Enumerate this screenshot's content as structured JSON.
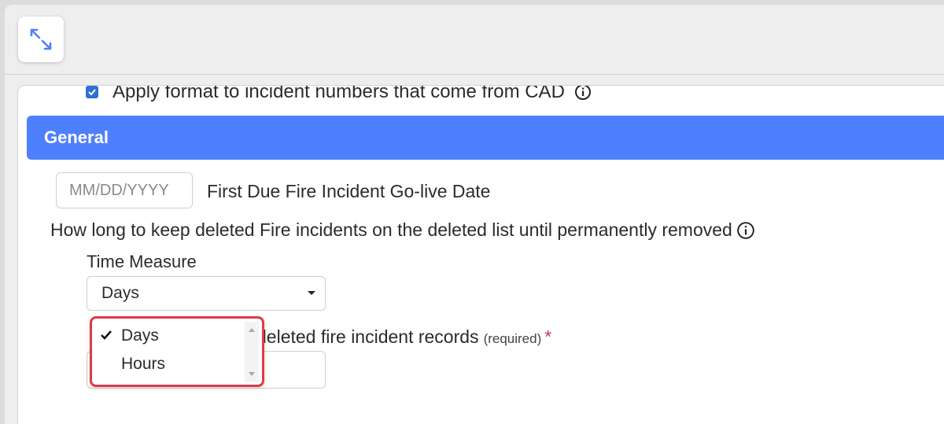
{
  "window": {
    "expand_icon": "expand-arrows-icon"
  },
  "cad": {
    "checked": true,
    "label": "Apply format to incident numbers that come from CAD",
    "info_icon": "info-circle-icon"
  },
  "general": {
    "header": "General",
    "golive_placeholder": "MM/DD/YYYY",
    "golive_label": "First Due Fire Incident Go-live Date",
    "retention_question": "How long to keep deleted Fire incidents on the deleted list until permanently removed",
    "time_measure_label": "Time Measure",
    "time_measure_value": "Days",
    "records_label_text": "deleted fire incident records",
    "records_required": "(required)",
    "required_marker": "*"
  },
  "dropdown": {
    "options": [
      {
        "label": "Days",
        "selected": true
      },
      {
        "label": "Hours",
        "selected": false
      }
    ],
    "highlight_color": "#e03a48"
  },
  "colors": {
    "accent": "#4e7ffc",
    "checkbox": "#2f6fd6",
    "required": "#c8385f"
  }
}
